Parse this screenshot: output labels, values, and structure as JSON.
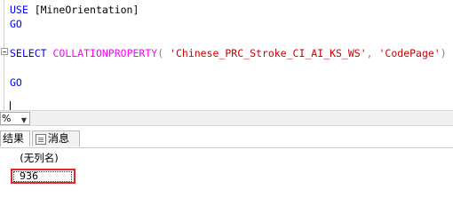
{
  "editor": {
    "line1": {
      "keyword": "USE",
      "rest": " [MineOrientation]"
    },
    "line2": {
      "keyword": "GO"
    },
    "line3": {
      "keyword": "SELECT",
      "function": "COLLATIONPROPERTY",
      "paren_open": "(",
      "arg1": "'Chinese_PRC_Stroke_CI_AI_KS_WS'",
      "comma": ",",
      "arg2": "'CodePage'",
      "paren_close": ")"
    },
    "line4": {
      "keyword": "GO"
    }
  },
  "zoom": {
    "value": "%"
  },
  "tabs": {
    "results_label": "结果",
    "messages_label": "消息"
  },
  "results": {
    "column_header": "(无列名)",
    "cell_value": "936"
  },
  "colors": {
    "keyword": "#0000ff",
    "function": "#ff00ff",
    "string": "#cc0000",
    "highlight_border": "#e0262f"
  }
}
